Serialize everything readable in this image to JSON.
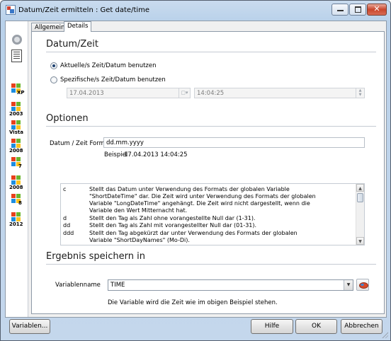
{
  "window": {
    "title": "Datum/Zeit ermitteln : Get date/time",
    "controls": {
      "minimize": "minimize-icon",
      "maximize": "maximize-icon",
      "close": "close-icon",
      "close_glyph": "✕"
    }
  },
  "sidebar": {
    "items": [
      {
        "icon": "circle-icon",
        "label": ""
      },
      {
        "icon": "document-icon",
        "label": ""
      },
      {
        "icon": "windows-logo-icon",
        "label": "XP"
      },
      {
        "icon": "windows-logo-icon",
        "label": "2003"
      },
      {
        "icon": "windows-logo-icon",
        "label": "Vista"
      },
      {
        "icon": "windows-logo-icon",
        "label": "2008"
      },
      {
        "icon": "windows-logo-icon",
        "label": "7"
      },
      {
        "icon": "windows-logo-icon",
        "label": "2008"
      },
      {
        "icon": "windows-logo-icon",
        "label": "8"
      },
      {
        "icon": "windows-logo-icon",
        "label": "2012"
      }
    ]
  },
  "tabs": [
    {
      "label": "Allgemein",
      "active": false
    },
    {
      "label": "Details",
      "active": true
    }
  ],
  "datetime": {
    "title": "Datum/Zeit",
    "option_current": "Aktuelle/s Zeit/Datum benutzen",
    "option_specific": "Spezifische/s Zeit/Datum benutzen",
    "selected": "current",
    "date_value": "17.04.2013",
    "time_value": "14:04:25"
  },
  "options": {
    "title": "Optionen",
    "format_label": "Datum / Zeit Format",
    "format_value": "dd.mm.yyyy",
    "example_label": "Beispiel",
    "example_value": "17.04.2013 14:04:25",
    "format_list": [
      {
        "code": "c",
        "lines": [
          "Stellt das Datum unter Verwendung des Formats der globalen Variable",
          "\"ShortDateTime\" dar. Die Zeit wird unter Verwendung des Formats der globalen",
          "Variable \"LongDateTime\" angehängt. Die Zeit wird nicht dargestellt, wenn die",
          "Variable den Wert Mitternacht hat."
        ]
      },
      {
        "code": "d",
        "lines": [
          "Stellt den Tag als Zahl ohne vorangestellte Null dar (1-31)."
        ]
      },
      {
        "code": "dd",
        "lines": [
          "Stellt den Tag als Zahl mit vorangestellter Null dar (01-31)."
        ]
      },
      {
        "code": "ddd",
        "lines": [
          "Stellt den Tag abgekürzt dar unter Verwendung des Formats der globalen",
          "Variable \"ShortDayNames\" (Mo-Di)."
        ]
      }
    ]
  },
  "result": {
    "title": "Ergebnis speichern in",
    "variable_label": "Variablenname",
    "variable_value": "TIME",
    "note": "Die Variable wird  die Zeit wie im obigen Beispiel stehen."
  },
  "buttons": {
    "variables": "Variablen...",
    "help": "Hilfe",
    "ok": "OK",
    "cancel": "Abbrechen"
  }
}
